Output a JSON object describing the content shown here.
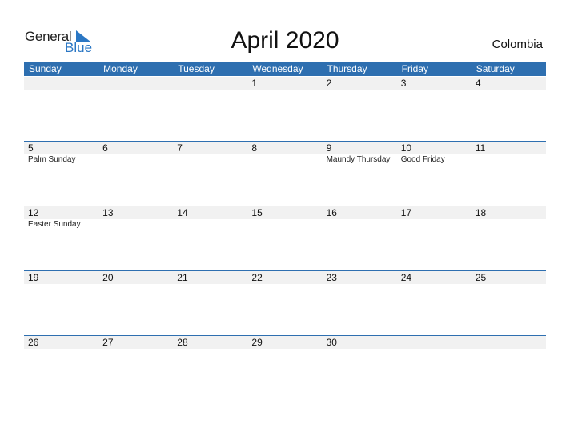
{
  "logo": {
    "general": "General",
    "blue": "Blue"
  },
  "title": "April 2020",
  "country": "Colombia",
  "weekdays": [
    "Sunday",
    "Monday",
    "Tuesday",
    "Wednesday",
    "Thursday",
    "Friday",
    "Saturday"
  ],
  "weeks": [
    [
      {
        "d": ""
      },
      {
        "d": ""
      },
      {
        "d": ""
      },
      {
        "d": "1"
      },
      {
        "d": "2"
      },
      {
        "d": "3"
      },
      {
        "d": "4"
      }
    ],
    [
      {
        "d": "5",
        "e": "Palm Sunday"
      },
      {
        "d": "6"
      },
      {
        "d": "7"
      },
      {
        "d": "8"
      },
      {
        "d": "9",
        "e": "Maundy Thursday"
      },
      {
        "d": "10",
        "e": "Good Friday"
      },
      {
        "d": "11"
      }
    ],
    [
      {
        "d": "12",
        "e": "Easter Sunday"
      },
      {
        "d": "13"
      },
      {
        "d": "14"
      },
      {
        "d": "15"
      },
      {
        "d": "16"
      },
      {
        "d": "17"
      },
      {
        "d": "18"
      }
    ],
    [
      {
        "d": "19"
      },
      {
        "d": "20"
      },
      {
        "d": "21"
      },
      {
        "d": "22"
      },
      {
        "d": "23"
      },
      {
        "d": "24"
      },
      {
        "d": "25"
      }
    ],
    [
      {
        "d": "26"
      },
      {
        "d": "27"
      },
      {
        "d": "28"
      },
      {
        "d": "29"
      },
      {
        "d": "30"
      },
      {
        "d": ""
      },
      {
        "d": ""
      }
    ]
  ],
  "colors": {
    "accent": "#2e6fb0",
    "logo_blue": "#2b77c4",
    "date_row_bg": "#f1f1f1"
  }
}
